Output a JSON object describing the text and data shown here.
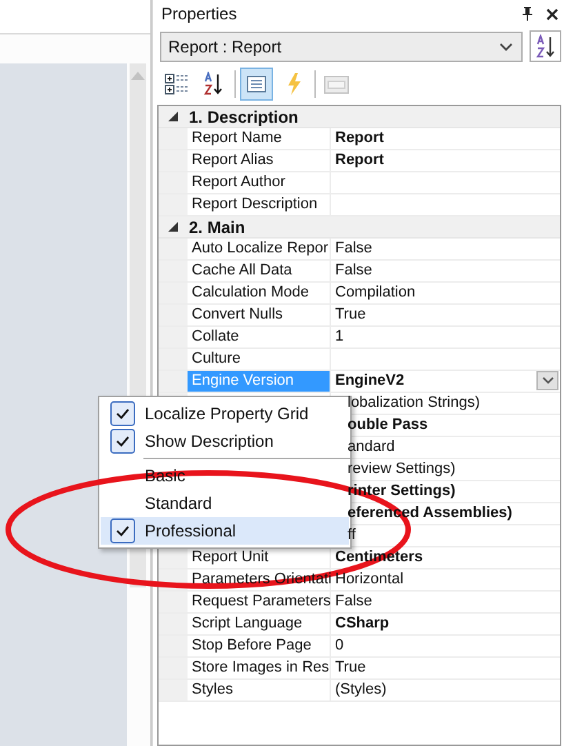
{
  "panel": {
    "title": "Properties"
  },
  "object_selector": {
    "value": "Report : Report"
  },
  "toolbar": [
    {
      "kind": "categorized",
      "selected": false,
      "disabled": false
    },
    {
      "kind": "alphabetical",
      "selected": false,
      "disabled": false
    },
    {
      "kind": "properties",
      "selected": true,
      "disabled": false
    },
    {
      "kind": "events",
      "selected": false,
      "disabled": false
    },
    {
      "kind": "pages",
      "selected": false,
      "disabled": true
    }
  ],
  "grid": {
    "groups": [
      {
        "title": "1. Description",
        "expanded": true,
        "rows": [
          {
            "name": "Report Name",
            "value": "Report",
            "bold": true,
            "selected": false
          },
          {
            "name": "Report Alias",
            "value": "Report",
            "bold": true,
            "selected": false
          },
          {
            "name": "Report Author",
            "selected": false
          },
          {
            "name": "Report Description",
            "selected": false
          }
        ]
      },
      {
        "title": "2. Main",
        "expanded": true,
        "rows": [
          {
            "name": "Auto Localize Repor",
            "value": "False",
            "bold": false,
            "selected": false
          },
          {
            "name": "Cache All Data",
            "value": "False",
            "bold": false,
            "selected": false
          },
          {
            "name": "Calculation Mode",
            "value": "Compilation",
            "bold": false,
            "selected": false
          },
          {
            "name": "Convert Nulls",
            "value": "True",
            "bold": false,
            "selected": false
          },
          {
            "name": "Collate",
            "value": "1",
            "bold": false,
            "selected": false
          },
          {
            "name": "Culture",
            "selected": false
          },
          {
            "name": "Engine Version",
            "value": "EngineV2",
            "bold": true,
            "selected": true
          },
          {
            "value": "lobalization Strings)",
            "bold": false
          },
          {
            "value": "ouble Pass",
            "bold": true
          },
          {
            "value": "andard",
            "bold": false
          },
          {
            "value": "review Settings)",
            "bold": false
          },
          {
            "value": "rinter Settings)",
            "bold": true
          },
          {
            "value": "eferenced Assemblies)",
            "bold": true
          },
          {
            "value": "ff",
            "bold": false
          },
          {
            "name": "Report Unit",
            "value": "Centimeters",
            "bold": true,
            "selected": false
          },
          {
            "name": "Parameters Orientati",
            "value": "Horizontal",
            "bold": false,
            "selected": false
          },
          {
            "name": "Request Parameters",
            "value": "False",
            "bold": false,
            "selected": false
          },
          {
            "name": "Script Language",
            "value": "CSharp",
            "bold": true,
            "selected": false
          },
          {
            "name": "Stop Before Page",
            "value": "0",
            "bold": false,
            "selected": false
          },
          {
            "name": "Store Images in Res",
            "value": "True",
            "bold": false,
            "selected": false
          },
          {
            "name": "Styles",
            "value": "(Styles)",
            "bold": false,
            "selected": false
          }
        ]
      }
    ]
  },
  "context_menu": {
    "items": [
      {
        "kind": "check",
        "label": "Localize Property Grid",
        "checked": true,
        "selected": false
      },
      {
        "kind": "check",
        "label": "Show Description",
        "checked": true,
        "selected": false
      },
      {
        "kind": "separator"
      },
      {
        "kind": "check",
        "label": "Basic",
        "checked": false,
        "selected": false
      },
      {
        "kind": "check",
        "label": "Standard",
        "checked": false,
        "selected": false
      },
      {
        "kind": "check",
        "label": "Professional",
        "checked": true,
        "selected": true
      }
    ]
  }
}
